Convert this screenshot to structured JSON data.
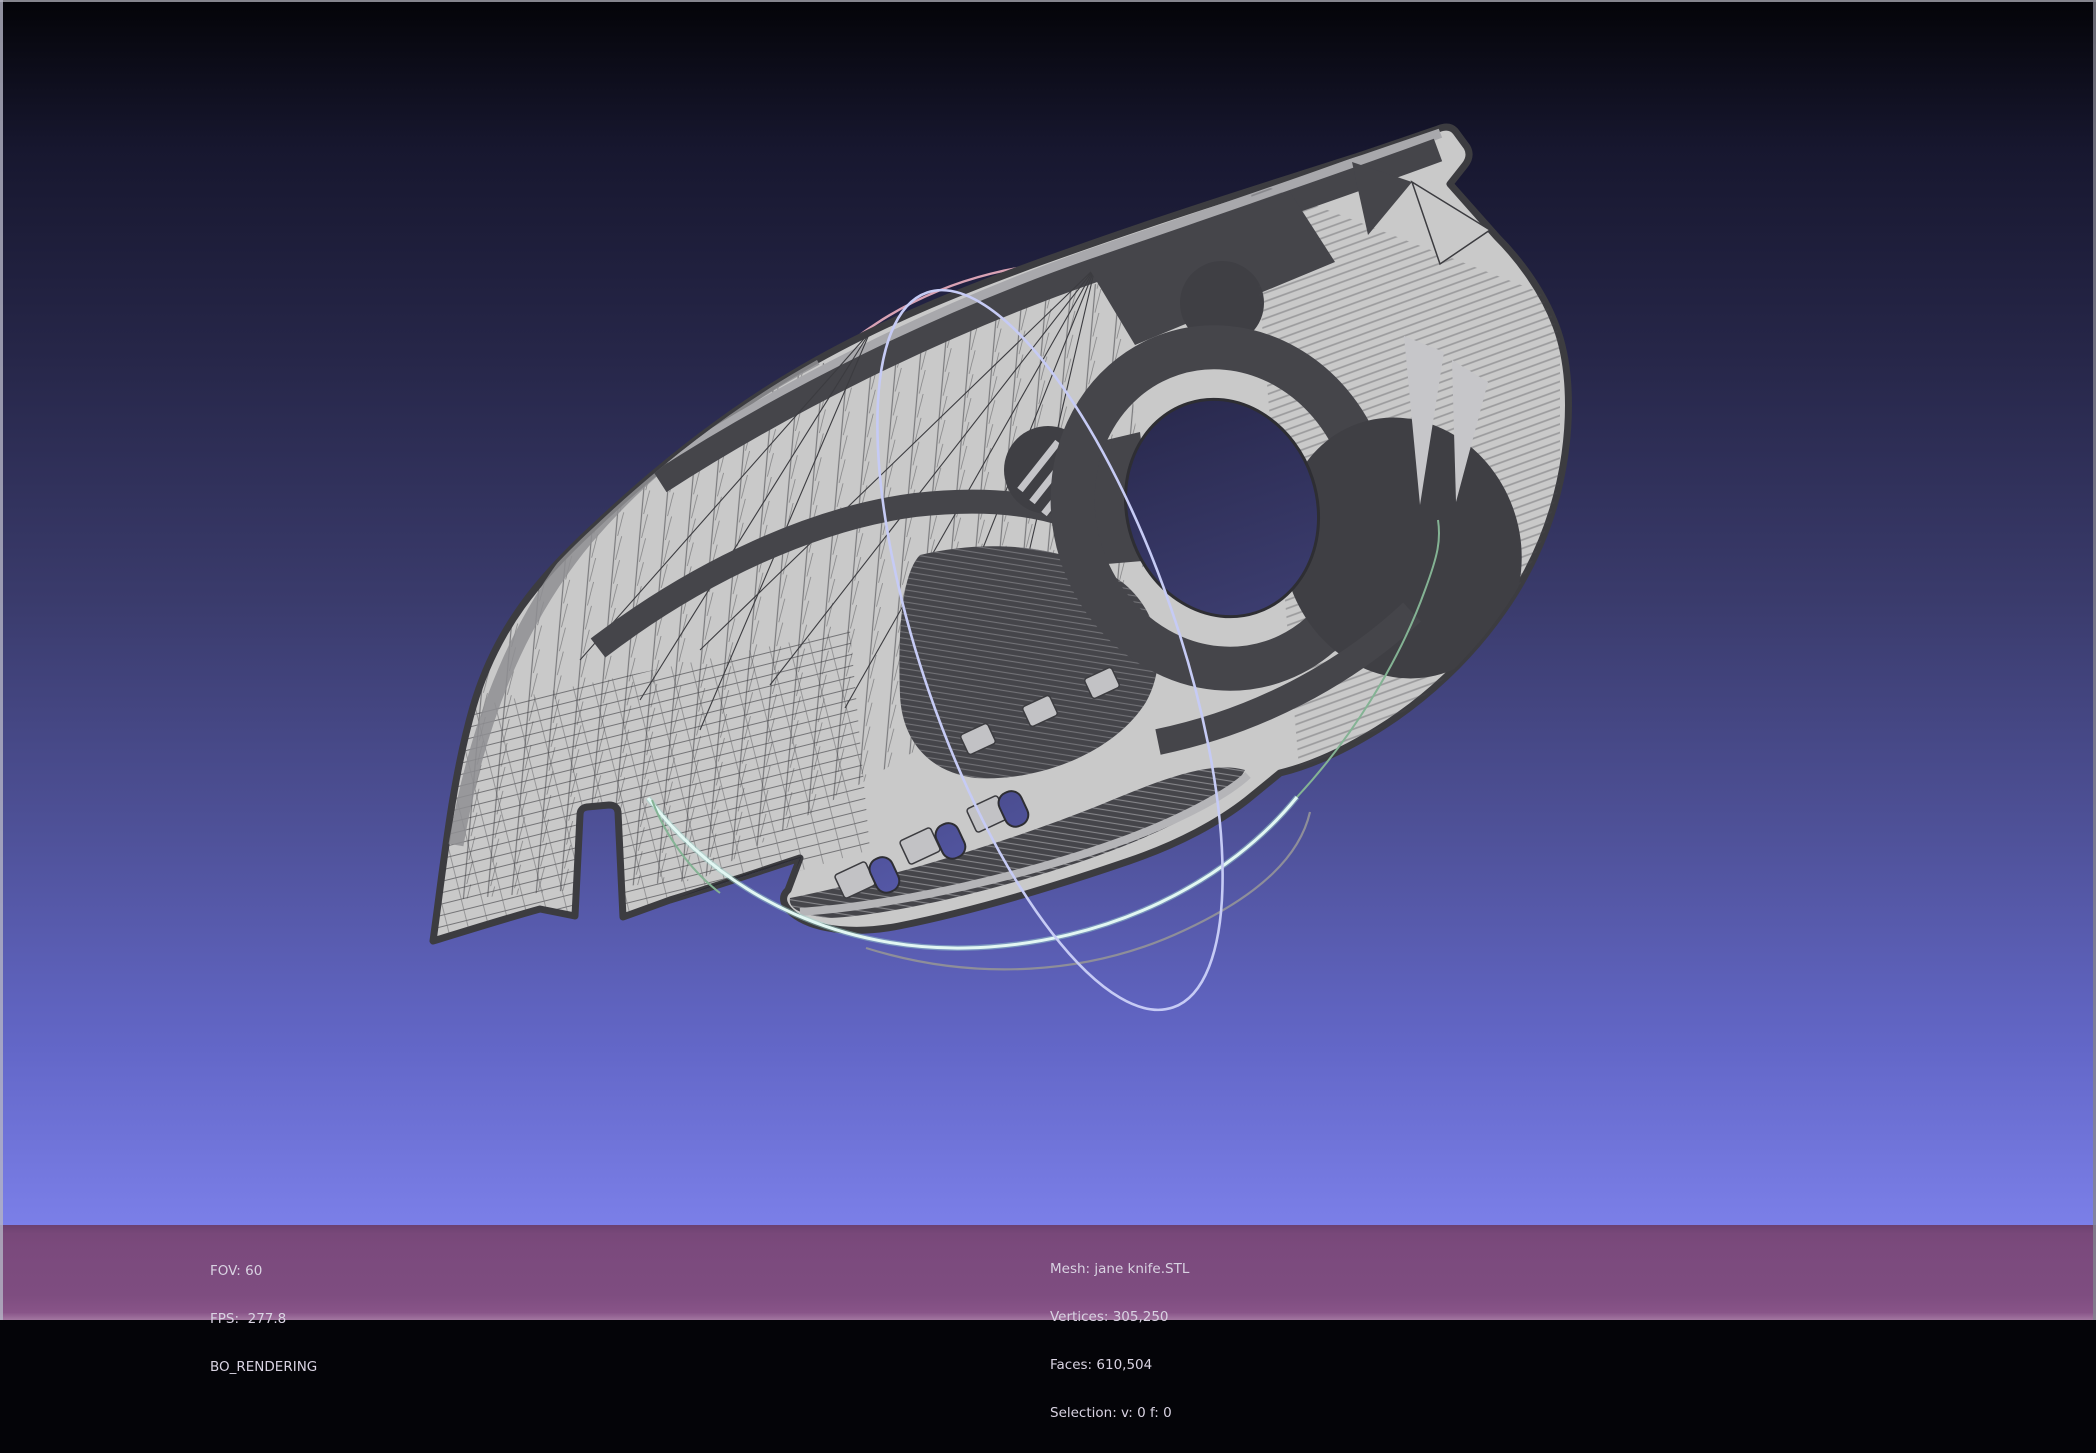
{
  "viewport_hud": {
    "left": {
      "fov": "FOV: 60",
      "fps": "FPS:  277.8",
      "render_mode": "BO_RENDERING"
    },
    "mesh_info": {
      "mesh": "Mesh: jane knife.STL",
      "vertices": "Vertices: 305,250",
      "faces": "Faces: 610,504",
      "selection": "Selection: v: 0 f: 0"
    }
  },
  "scene": {
    "model_name": "jane knife.STL",
    "render_style": "wireframe-mesh",
    "trackball": {
      "pink": "#d9a2b4",
      "lavender": "#c6cbf5",
      "cyan": "#e2f7f3",
      "cyan_glow": "#9fd8cf",
      "green_dim": "#84b394",
      "gray": "#8e8e99"
    }
  },
  "colors": {
    "background_top": "#040408",
    "background_bottom": "#7b7fe8",
    "status_bar": "#7b4a7d",
    "hud_text": "#d9d3e2",
    "mesh_light": "#c9c9c9",
    "mesh_mid": "#a8a8ac",
    "mesh_dark": "#45454a",
    "mesh_outline": "#3c3c40"
  }
}
